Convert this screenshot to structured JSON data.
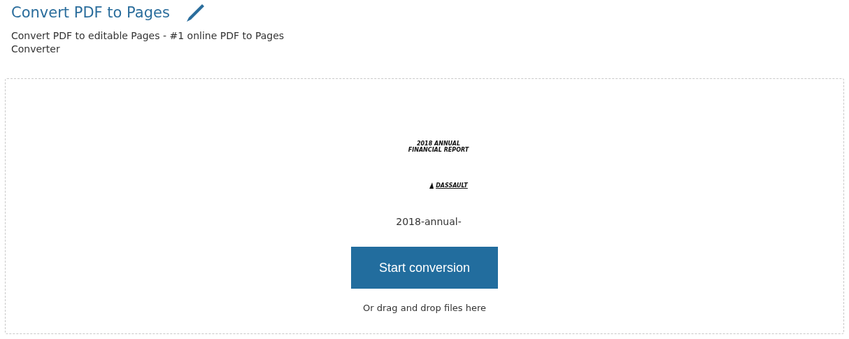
{
  "header": {
    "title": "Convert PDF to Pages",
    "subtitle": "Convert PDF to editable Pages - #1 online PDF to Pages Converter"
  },
  "dropzone": {
    "file": {
      "preview_lines": [
        "2018 ANNUAL",
        "FINANCIAL REPORT"
      ],
      "preview_logo": "DASSAULT",
      "name": "2018-annual-"
    },
    "button": "Start conversion",
    "hint": "Or drag and drop files here"
  }
}
